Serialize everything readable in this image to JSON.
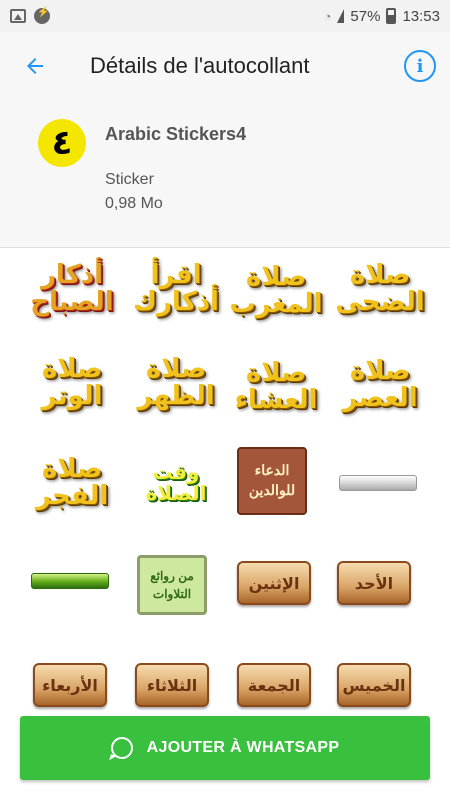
{
  "status_bar": {
    "battery_text": "57%",
    "time": "13:53",
    "icons": [
      "image-icon",
      "messenger-icon",
      "wifi-icon",
      "signal-icon",
      "battery-icon"
    ]
  },
  "app_bar": {
    "title": "Détails de l'autocollant",
    "back_icon": "arrow-back-icon",
    "info_icon": "info-icon",
    "accent_color": "#2196f3"
  },
  "pack": {
    "icon_glyph": "٤",
    "name": "Arabic Stickers4",
    "type": "Sticker",
    "size": "0,98 Mo"
  },
  "stickers": [
    {
      "kind": "gold",
      "text": "أذكار الصباح",
      "tone": "red"
    },
    {
      "kind": "gold",
      "text": "اقرأ أذكارك",
      "tone": "gold"
    },
    {
      "kind": "gold",
      "text": "صلاة المغرب",
      "tone": "gold"
    },
    {
      "kind": "gold",
      "text": "صلاة الضحى",
      "tone": "gold"
    },
    {
      "kind": "gold",
      "text": "صلاة الوتر",
      "tone": "gold"
    },
    {
      "kind": "gold",
      "text": "صلاة الظهر",
      "tone": "gold"
    },
    {
      "kind": "gold",
      "text": "صلاة العشاء",
      "tone": "gold"
    },
    {
      "kind": "gold",
      "text": "صلاة العصر",
      "tone": "gold"
    },
    {
      "kind": "gold",
      "text": "صلاة الفجر",
      "tone": "gold"
    },
    {
      "kind": "waqt",
      "text": "وقت الصلاة"
    },
    {
      "kind": "dua",
      "text": "الدعاء للوالدين"
    },
    {
      "kind": "banner-silver",
      "text": ""
    },
    {
      "kind": "banner-green",
      "text": ""
    },
    {
      "kind": "green-card",
      "text": "من روائع التلاوات"
    },
    {
      "kind": "plaque",
      "text": "الإثنين"
    },
    {
      "kind": "plaque",
      "text": "الأحد"
    },
    {
      "kind": "plaque",
      "text": "الأربعاء"
    },
    {
      "kind": "plaque",
      "text": "الثلاثاء"
    },
    {
      "kind": "plaque",
      "text": "الجمعة"
    },
    {
      "kind": "plaque",
      "text": "الخميس"
    }
  ],
  "action": {
    "label": "AJOUTER À WHATSAPP",
    "icon": "whatsapp-icon",
    "color": "#3ac03f"
  }
}
